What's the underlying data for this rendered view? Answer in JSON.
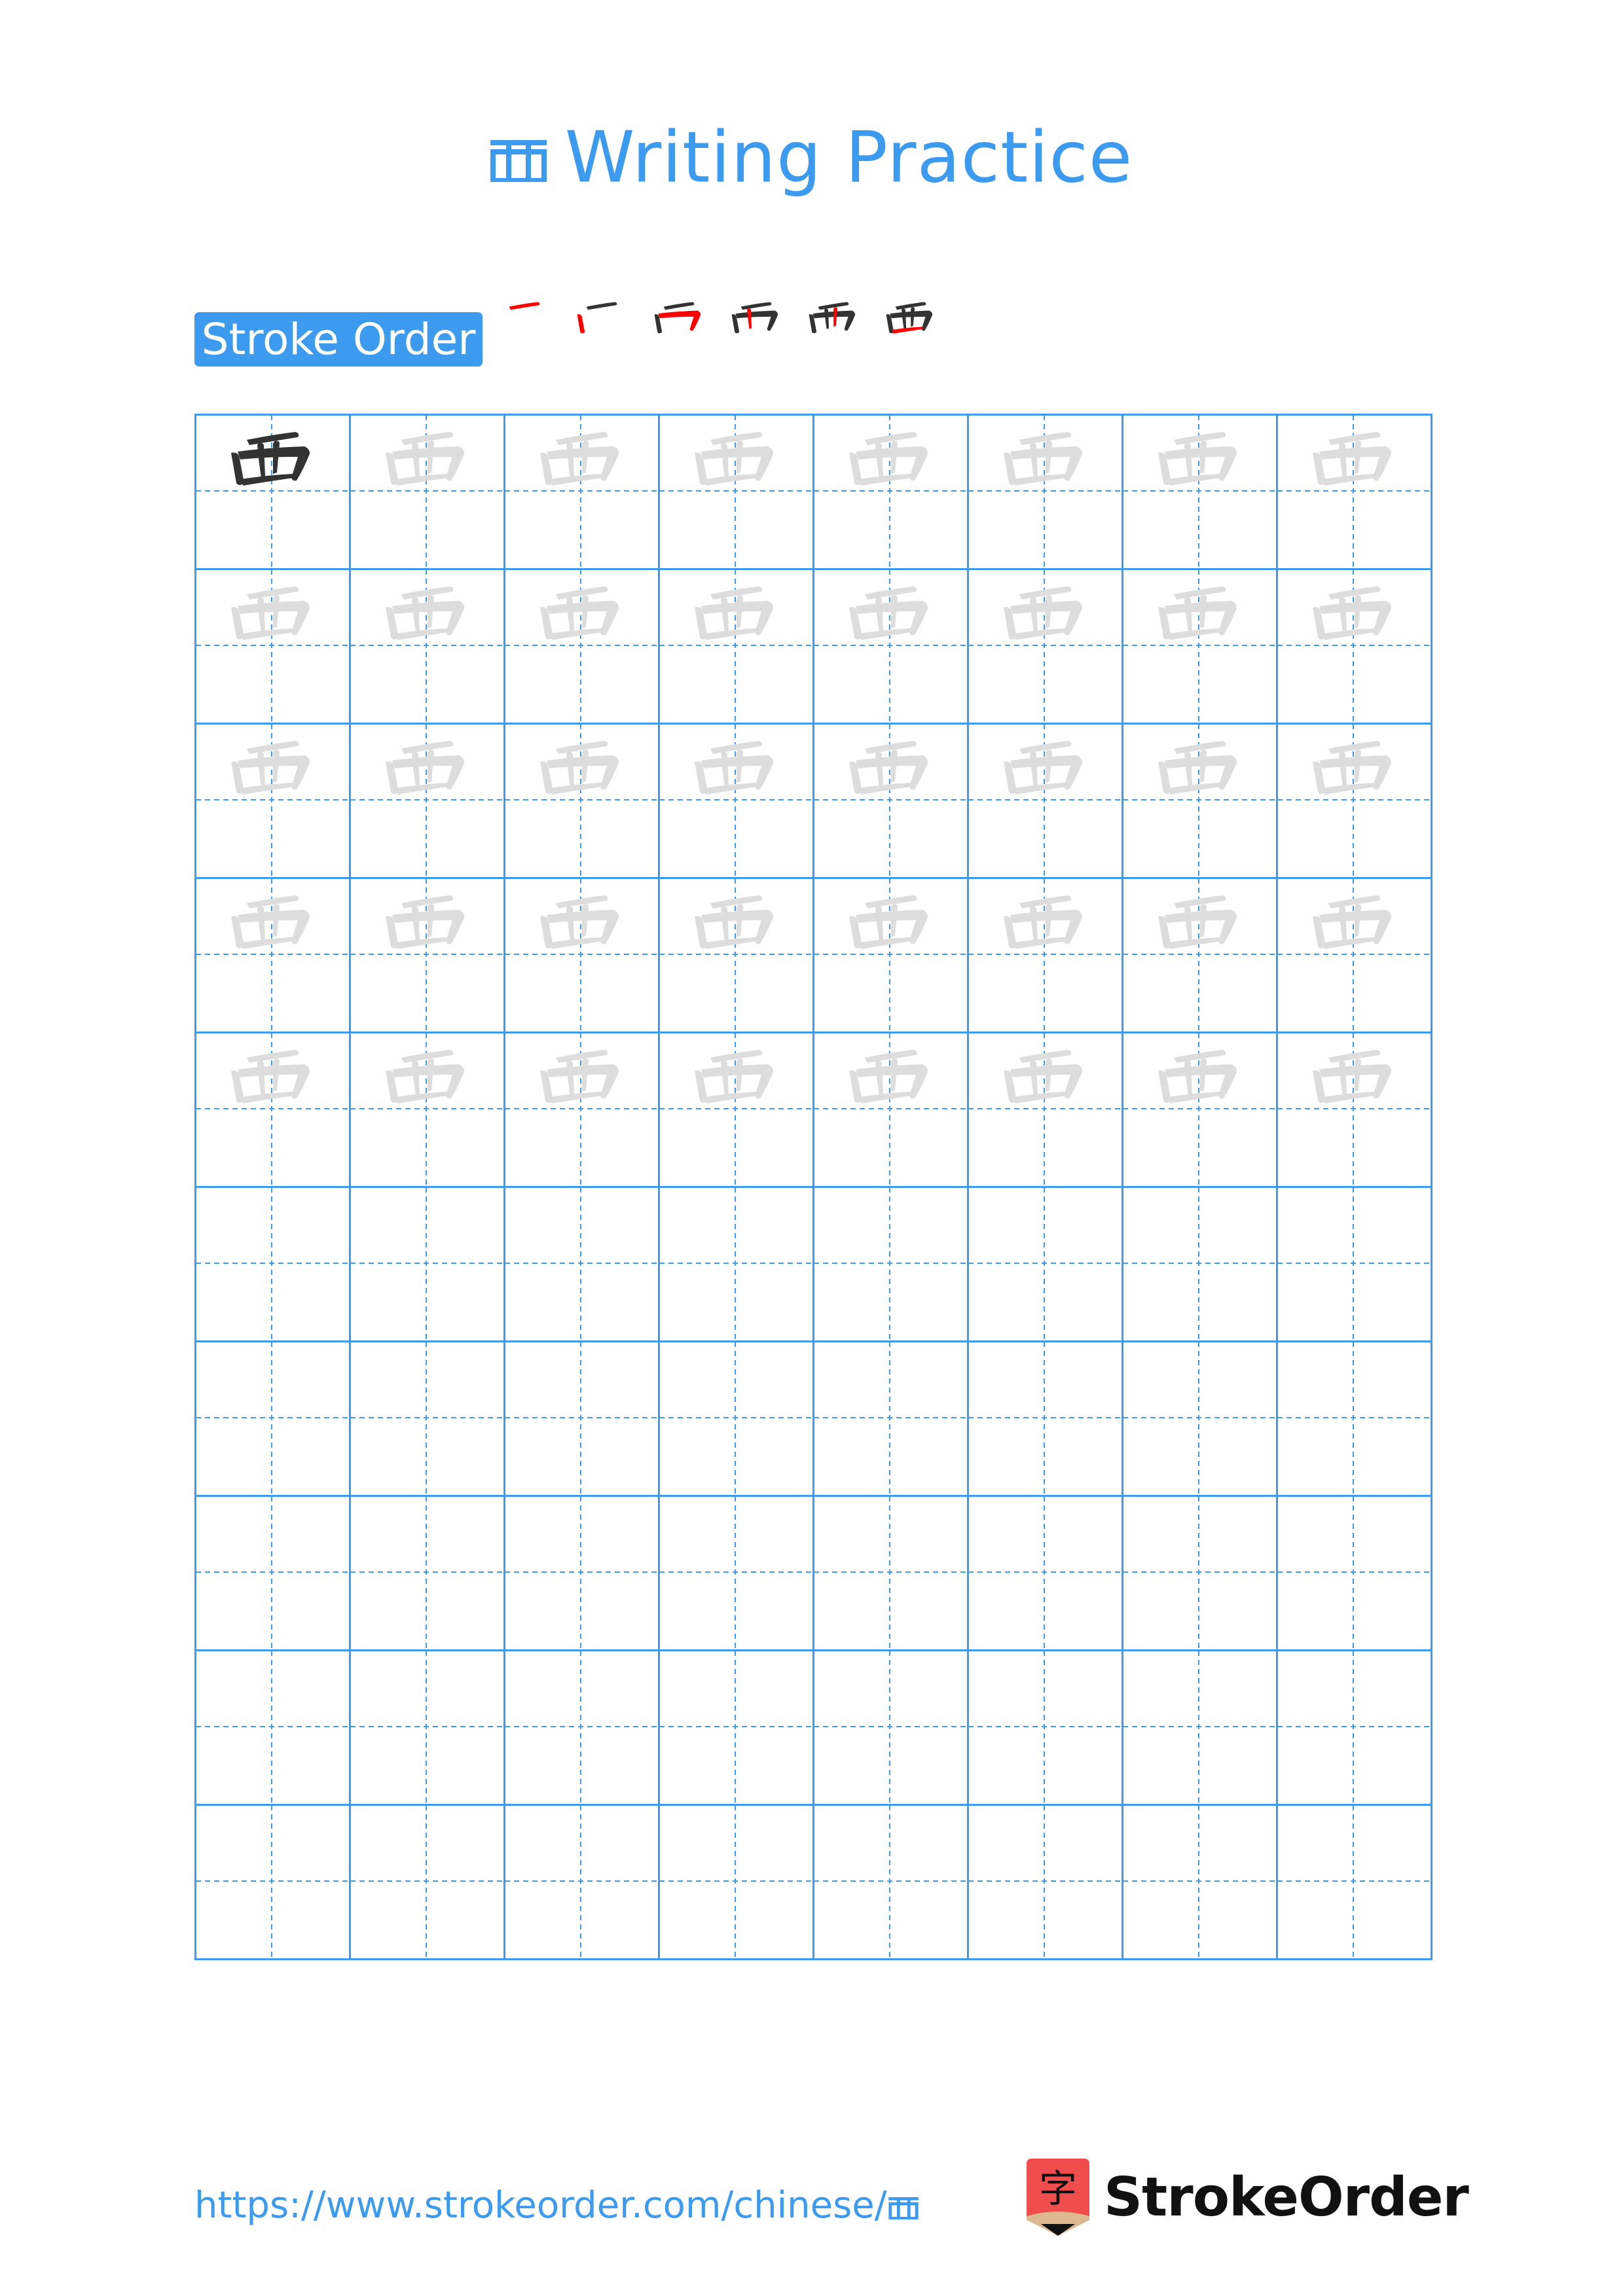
{
  "page": {
    "character": "覀",
    "title_suffix": "Writing Practice",
    "badge_label": "Stroke Order",
    "stroke_count": 6,
    "footer_url": "https://www.strokeorder.com/chinese/",
    "footer_url_char": "覀",
    "brand_name": "StrokeOrder",
    "brand_mark_char": "字"
  },
  "colors": {
    "accent": "#3d9bef",
    "grid_line": "#3d9bef",
    "model_glyph": "#333333",
    "trace_glyph": "#dddddd",
    "stroke_highlight": "#ff0000",
    "stroke_done": "#333333",
    "logo_red": "#f04e4e",
    "logo_tan": "#dcb991"
  },
  "grid": {
    "columns": 8,
    "rows": 10,
    "guide_rows": 5,
    "model_cells": 1
  }
}
